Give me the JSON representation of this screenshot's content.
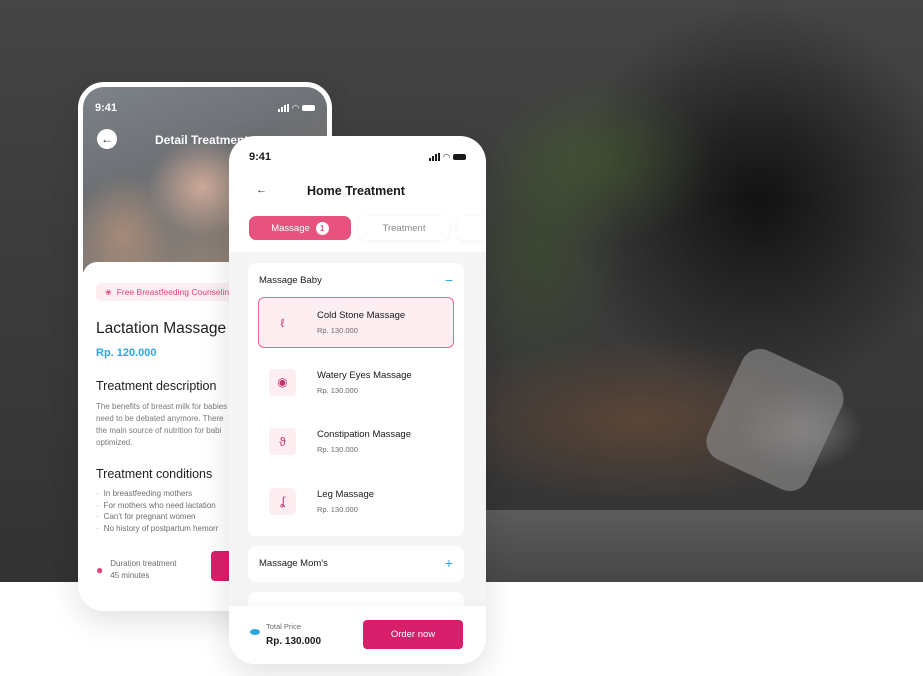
{
  "background": {
    "description": "massage-photo"
  },
  "detail_screen": {
    "status_time": "9:41",
    "back_icon": "arrow-left-icon",
    "title": "Detail Treatment",
    "promo_icon": "paw-icon",
    "promo_label": "Free Breastfeeding Counseling",
    "treatment_name": "Lactation Massage",
    "price": "Rp. 120.000",
    "description_heading": "Treatment description",
    "description_lines": [
      "The benefits of breast milk for babies",
      "need to be debated anymore. There",
      "the main source of nutrition for babi",
      "optimized."
    ],
    "conditions_heading": "Treatment conditions",
    "conditions": [
      "In breastfeeding mothers",
      "For mothers who need lactation",
      "Can't for pregnant women",
      "No history of postpartum hemorr"
    ],
    "duration_label": "Duration treatment",
    "duration_value": "45 minutes"
  },
  "home_screen": {
    "status_time": "9:41",
    "title": "Home Treatment",
    "tabs": [
      {
        "label": "Massage",
        "badge": "1",
        "active": true
      },
      {
        "label": "Treatment",
        "active": false
      },
      {
        "label": "",
        "active": false
      }
    ],
    "groups": [
      {
        "title": "Massage Baby",
        "expanded": true,
        "toggle": "−",
        "items": [
          {
            "name": "Cold Stone Massage",
            "price": "Rp. 130.000",
            "icon": "nose-icon",
            "glyph": "ℓ",
            "selected": true
          },
          {
            "name": "Watery Eyes Massage",
            "price": "Rp. 130.000",
            "icon": "eye-icon",
            "glyph": "◉",
            "selected": false
          },
          {
            "name": "Constipation Massage",
            "price": "Rp. 130.000",
            "icon": "stomach-icon",
            "glyph": "ϑ",
            "selected": false
          },
          {
            "name": "Leg Massage",
            "price": "Rp. 130.000",
            "icon": "leg-icon",
            "glyph": "ʆ",
            "selected": false
          }
        ]
      },
      {
        "title": "Massage Mom's",
        "expanded": false,
        "toggle": "+"
      }
    ],
    "total_label": "Total Price",
    "total_value": "Rp. 130.000",
    "order_button": "Order now"
  },
  "colors": {
    "primary": "#d81f6b",
    "tab_active": "#e8527e",
    "accent_blue": "#2ba7e0",
    "pink_light": "#fdeef2"
  }
}
